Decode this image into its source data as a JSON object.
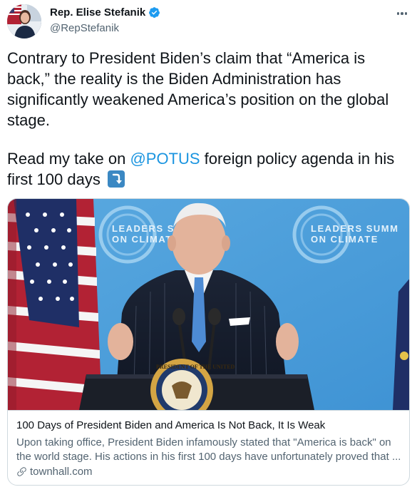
{
  "author": {
    "display_name": "Rep. Elise Stefanik",
    "handle": "@RepStefanik"
  },
  "tweet": {
    "text_line1": "Contrary to President Biden’s claim that “America is",
    "text_line2": "back,” the reality is the Biden Administration has",
    "text_line3": "significantly weakened America’s position on the global",
    "text_line4": "stage.",
    "para2_before": "Read my take on ",
    "para2_mention": "@POTUS",
    "para2_after": " foreign policy agenda in his",
    "para2_line2": "first 100 days"
  },
  "card": {
    "image_banner_left": "LEADERS S",
    "image_banner_left2": "ON CLIMAT",
    "image_banner_right": "LEADERS SUMM",
    "image_banner_right2": "ON CLIMATE",
    "seal_text": "PRESIDENT OF THE UNITED",
    "title": "100 Days of President Biden and America Is Not Back, It Is Weak",
    "description_line1": "Upon taking office, President Biden infamously stated that \"America is back\" on",
    "description_line2": "the world stage. His actions in his first 100 days have unfortunately proved that ...",
    "domain": "townhall.com"
  },
  "colors": {
    "link": "#1b95e0",
    "verified": "#1d9bf0",
    "secondary_text": "#536471",
    "border": "#cfd9de"
  },
  "icons": [
    "verified-badge-icon",
    "more-options-icon",
    "arrow-down-emoji-icon",
    "link-icon"
  ]
}
